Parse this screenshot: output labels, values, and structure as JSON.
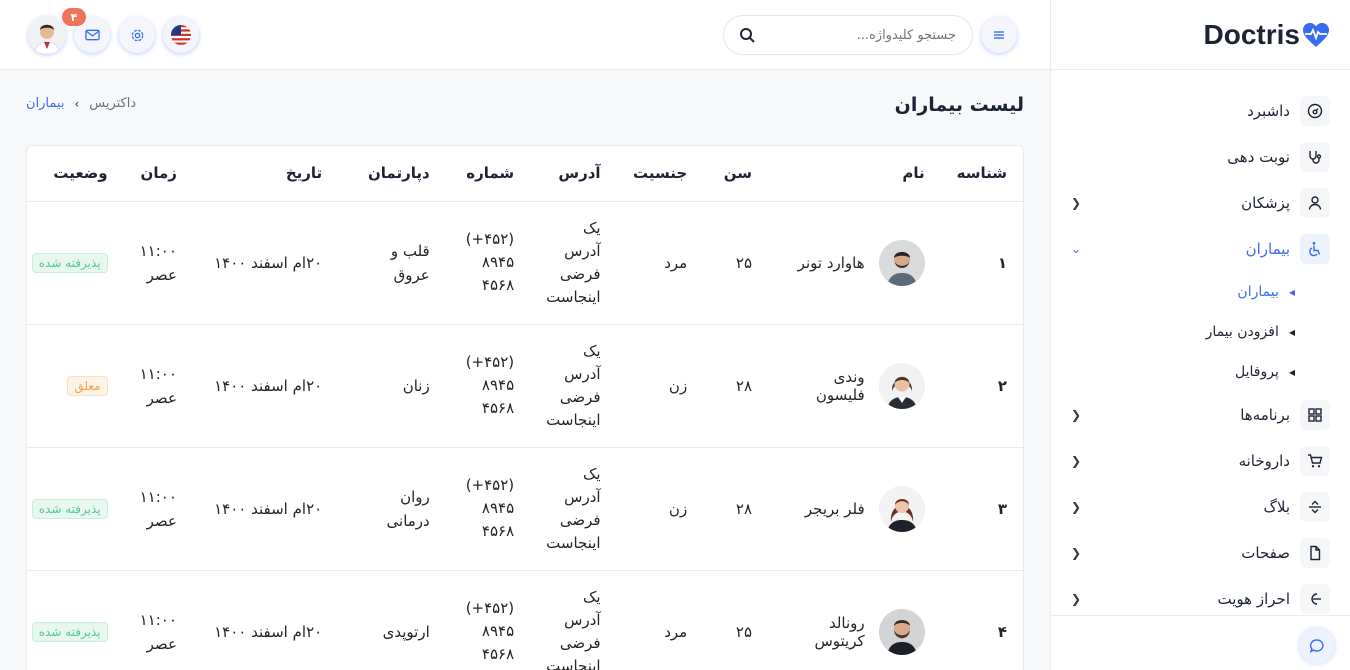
{
  "brand": {
    "name": "Doctris"
  },
  "topbar": {
    "search_placeholder": "جستجو کلیدواژه...",
    "notification_count": "۴"
  },
  "page": {
    "title": "لیست بیماران",
    "breadcrumb": {
      "home": "داکتریس",
      "current": "بیماران"
    }
  },
  "sidebar": {
    "items": [
      {
        "label": "داشبرد",
        "icon": "dashboard-icon"
      },
      {
        "label": "نوبت دهی",
        "icon": "stethoscope-icon"
      },
      {
        "label": "پزشکان",
        "icon": "user-icon"
      },
      {
        "label": "بیماران",
        "icon": "wheelchair-icon"
      },
      {
        "label": "برنامه‌ها",
        "icon": "apps-icon"
      },
      {
        "label": "داروخانه",
        "icon": "cart-icon"
      },
      {
        "label": "بلاگ",
        "icon": "blog-icon"
      },
      {
        "label": "صفحات",
        "icon": "file-icon"
      },
      {
        "label": "احراز هویت",
        "icon": "login-icon"
      }
    ],
    "patients_sub": [
      {
        "label": "بیماران"
      },
      {
        "label": "افزودن بیمار"
      },
      {
        "label": "پروفایل"
      }
    ]
  },
  "table": {
    "headers": {
      "id": "شناسه",
      "name": "نام",
      "age": "سن",
      "gender": "جنسیت",
      "address": "آدرس",
      "phone": "شماره",
      "department": "دپارتمان",
      "date": "تاریخ",
      "time": "زمان",
      "status": "وضعیت"
    },
    "rows": [
      {
        "id": "۱",
        "name": "هاوارد تونر",
        "age": "۲۵",
        "gender": "مرد",
        "address": "یک آدرس فرضی اینجاست",
        "phone": "(+۴۵۲) ۸۹۴۵ ۴۵۶۸",
        "department": "قلب و عروق",
        "date": "۲۰ام اسفند ۱۴۰۰",
        "time": "۱۱:۰۰ عصر",
        "status": "پذیرفته شده",
        "status_type": "ok"
      },
      {
        "id": "۲",
        "name": "وندی فلیسون",
        "age": "۲۸",
        "gender": "زن",
        "address": "یک آدرس فرضی اینجاست",
        "phone": "(+۴۵۲) ۸۹۴۵ ۴۵۶۸",
        "department": "زنان",
        "date": "۲۰ام اسفند ۱۴۰۰",
        "time": "۱۱:۰۰ عصر",
        "status": "معلق",
        "status_type": "wait"
      },
      {
        "id": "۳",
        "name": "فلر بریجر",
        "age": "۲۸",
        "gender": "زن",
        "address": "یک آدرس فرضی اینجاست",
        "phone": "(+۴۵۲) ۸۹۴۵ ۴۵۶۸",
        "department": "روان درمانی",
        "date": "۲۰ام اسفند ۱۴۰۰",
        "time": "۱۱:۰۰ عصر",
        "status": "پذیرفته شده",
        "status_type": "ok"
      },
      {
        "id": "۴",
        "name": "رونالد کریتوس",
        "age": "۲۵",
        "gender": "مرد",
        "address": "یک آدرس فرضی اینجاست",
        "phone": "(+۴۵۲) ۸۹۴۵ ۴۵۶۸",
        "department": "ارتوپدی",
        "date": "۲۰ام اسفند ۱۴۰۰",
        "time": "۱۱:۰۰ عصر",
        "status": "پذیرفته شده",
        "status_type": "ok"
      }
    ]
  },
  "colors": {
    "accent": "#396cf0",
    "success": "#53c797",
    "warning": "#f1a44c",
    "danger": "#f0735a"
  }
}
